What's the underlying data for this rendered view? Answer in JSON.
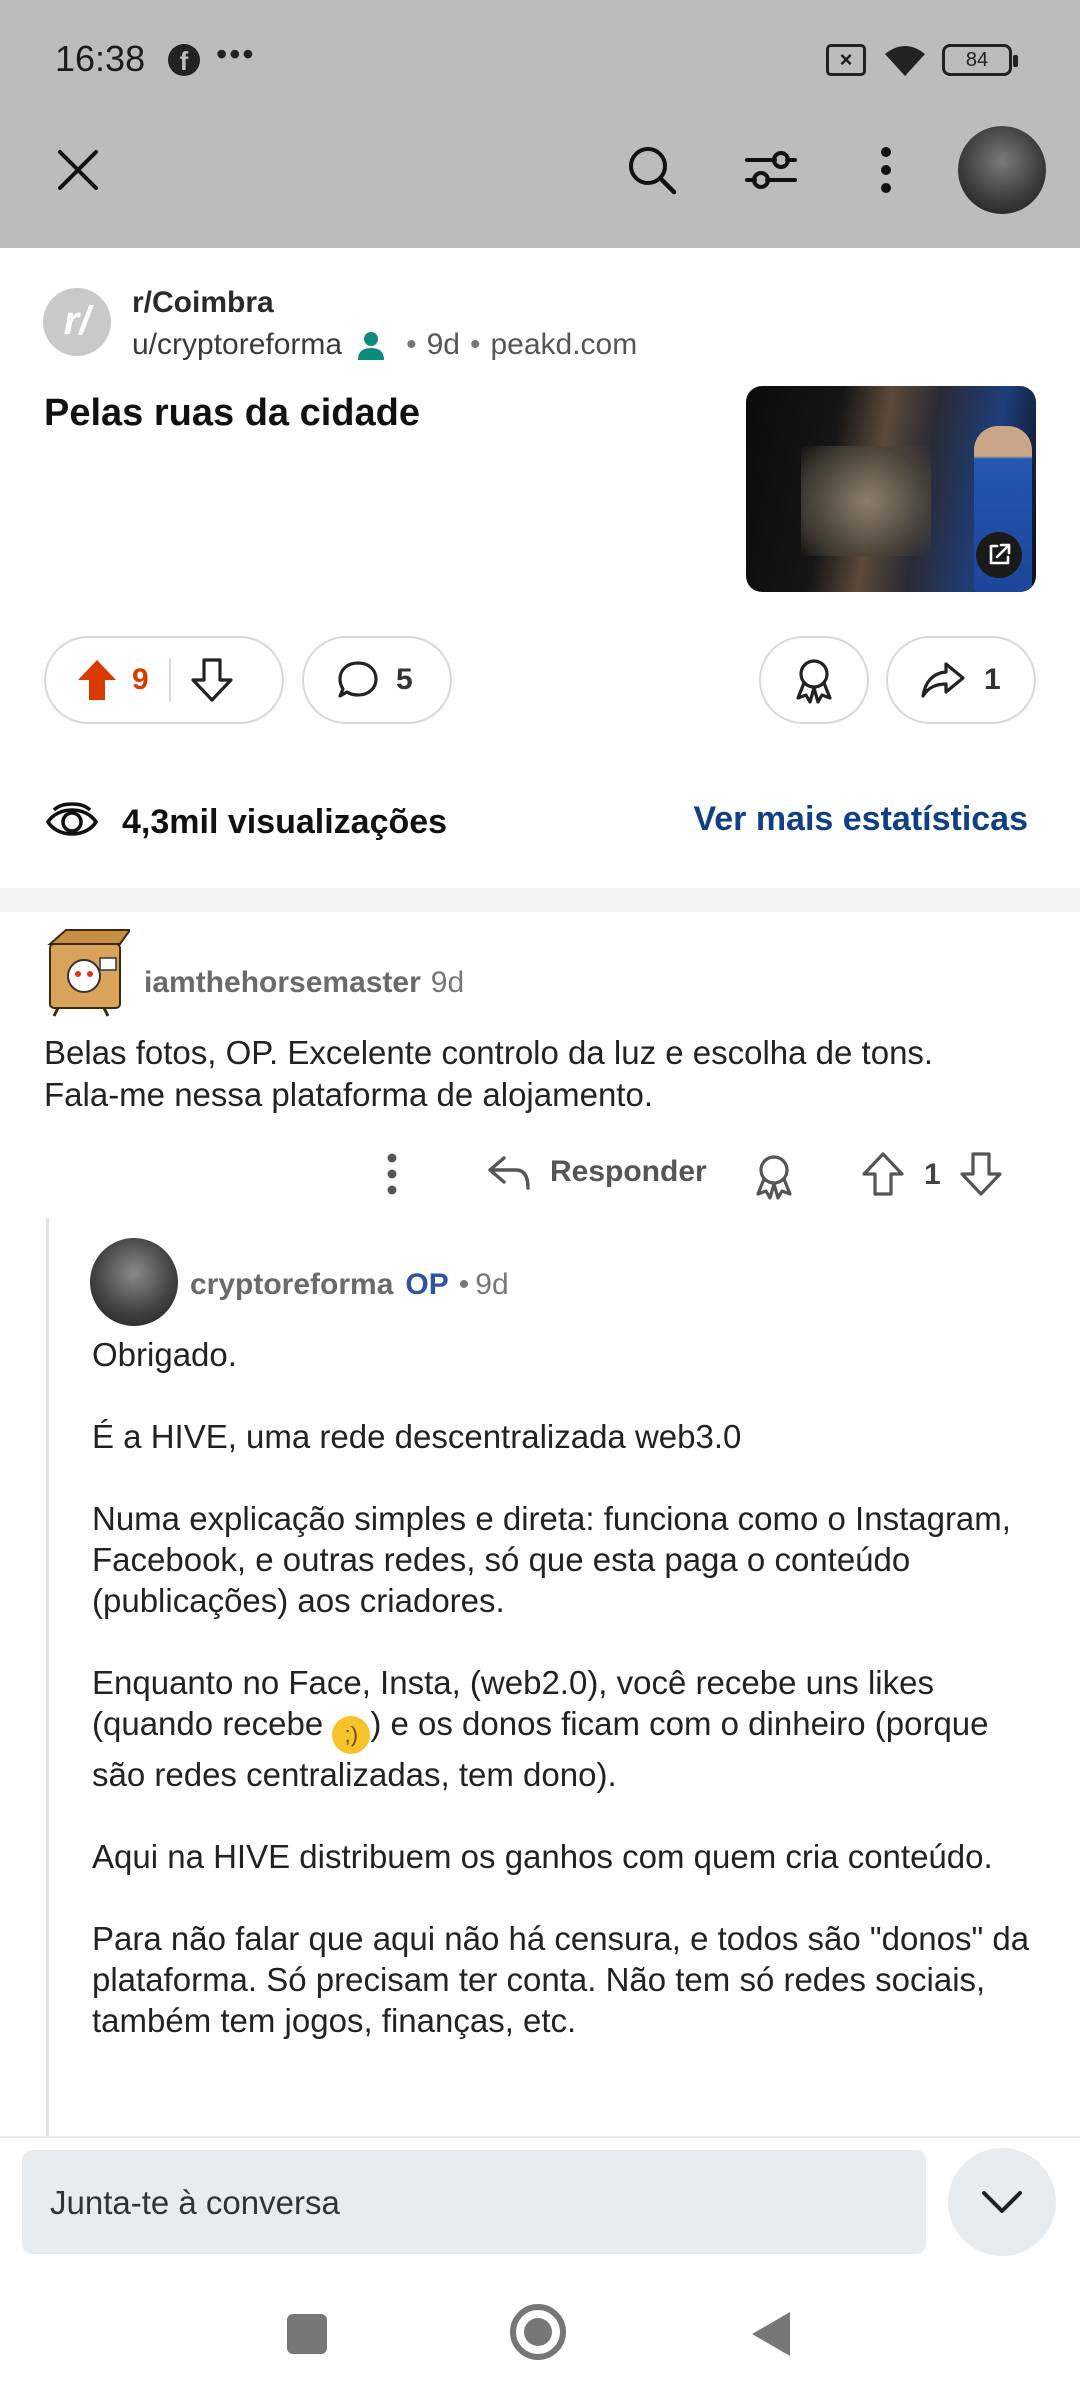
{
  "status_bar": {
    "time": "16:38",
    "notification_icons": [
      "facebook-icon",
      "more-dots-icon"
    ],
    "battery": "84"
  },
  "toolbar": {
    "close_icon": "close-icon",
    "search_icon": "search-icon",
    "sort_icon": "filter-icon",
    "menu_icon": "more-vertical-icon",
    "avatar": "user-avatar"
  },
  "post": {
    "subreddit": "r/Coimbra",
    "subreddit_avatar_text": "r/",
    "author": "u/cryptoreforma",
    "age": "9d",
    "domain": "peakd.com",
    "title": "Pelas ruas da cidade",
    "upvotes": "9",
    "comments": "5",
    "shares": "1",
    "views": "4,3mil visualizações",
    "stats_link": "Ver mais estatísticas",
    "colors": {
      "upvote": "#d93a00",
      "link": "#0f3f84",
      "op": "#2d54a3"
    }
  },
  "comments": [
    {
      "user": "iamthehorsemaster",
      "age": "9d",
      "body_line1": "Belas fotos, OP. Excelente controlo da luz e escolha de tons.",
      "body_line2": "Fala-me nessa plataforma de alojamento.",
      "reply_label": "Responder",
      "votes": "1"
    },
    {
      "user": "cryptoreforma",
      "op_badge": "OP",
      "age": "9d",
      "paragraphs": [
        "Obrigado.",
        "É a HIVE, uma rede descentralizada web3.0",
        "Numa explicação simples e direta: funciona como o Instagram, Facebook, e outras redes, só que esta paga o conteúdo (publicações) aos criadores.",
        "Enquanto no Face, Insta, (web2.0), você recebe uns likes (quando recebe",
        ") e os donos ficam com o dinheiro (porque são redes centralizadas, tem dono).",
        "Aqui na HIVE distribuem os ganhos com quem cria conteúdo.",
        "Para não falar que aqui não há censura, e todos são \"donos\" da plataforma. Só precisam ter conta. Não tem só redes sociais, também tem jogos, finanças, etc."
      ]
    }
  ],
  "composer": {
    "placeholder": "Junta-te à conversa"
  }
}
